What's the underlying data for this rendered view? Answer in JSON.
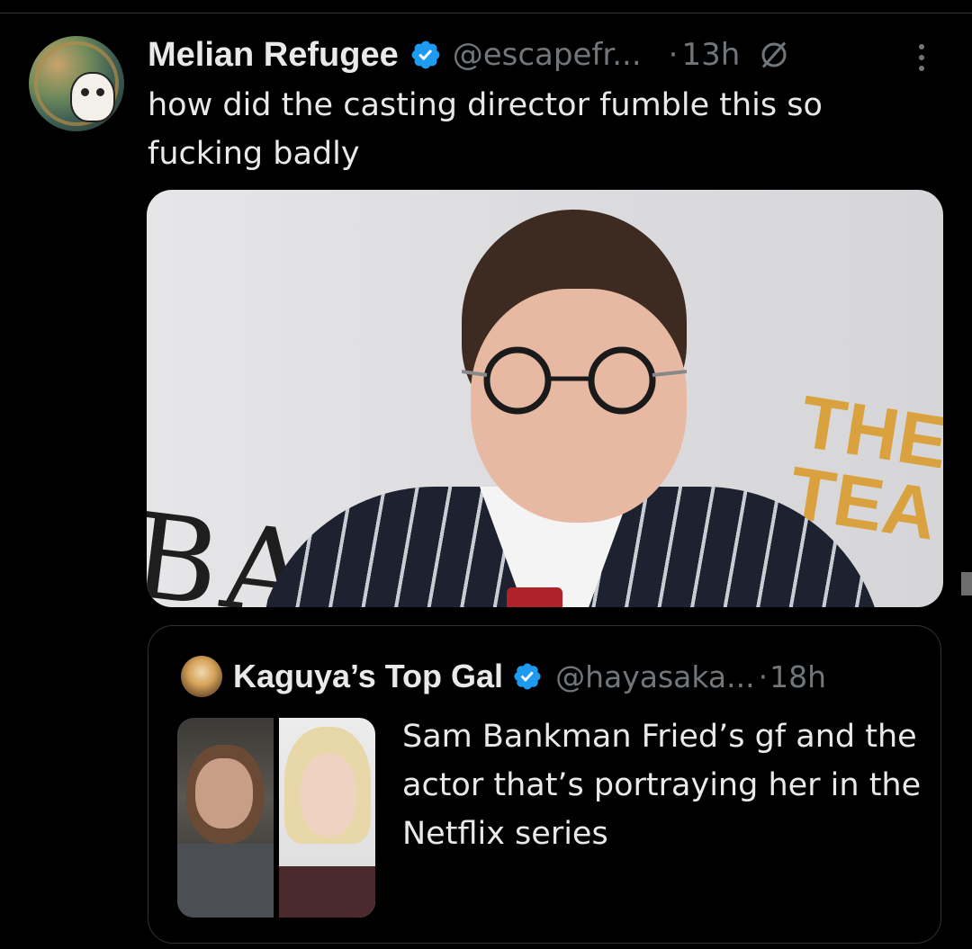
{
  "tweet": {
    "author_name": "Melian Refugee",
    "handle": "@escapefr...",
    "dot": "·",
    "time": "13h",
    "text": "how did the casting director fumble this so fucking badly"
  },
  "media": {
    "bafta_text": "BAFTA",
    "sign_text_1": "THE",
    "sign_text_2": "TEA"
  },
  "quote": {
    "author_name": "Kaguya’s Top Gal",
    "handle": "@hayasaka...",
    "dot": "·",
    "time": "18h",
    "text": "Sam Bankman Fried’s gf and the actor that’s portraying her in the Netflix series"
  },
  "icons": {
    "verified": "verified-badge-icon",
    "grok": "grok-icon",
    "more": "more-vertical-icon"
  },
  "colors": {
    "background": "#000000",
    "primary_text": "#e7e9ea",
    "secondary_text": "#71767b",
    "verified_blue": "#1d9bf0",
    "border": "#2f3336"
  }
}
